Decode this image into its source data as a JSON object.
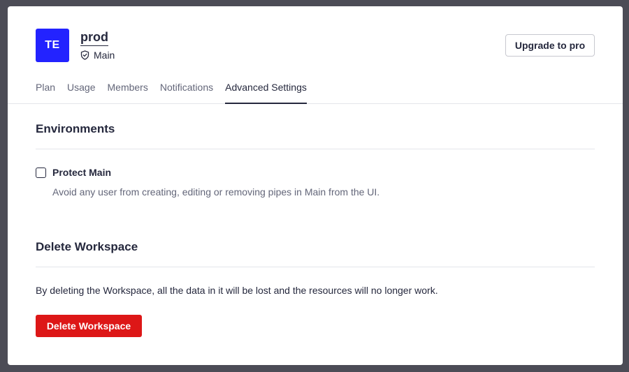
{
  "workspace": {
    "avatar_initials": "TE",
    "name": "prod",
    "environment_label": "Main",
    "environment_icon": "shield-icon",
    "avatar_color": "#2323ff"
  },
  "header": {
    "upgrade_label": "Upgrade to pro"
  },
  "tabs": [
    {
      "label": "Plan",
      "active": false
    },
    {
      "label": "Usage",
      "active": false
    },
    {
      "label": "Members",
      "active": false
    },
    {
      "label": "Notifications",
      "active": false
    },
    {
      "label": "Advanced Settings",
      "active": true
    }
  ],
  "environments": {
    "title": "Environments",
    "protect_main": {
      "label": "Protect Main",
      "checked": false,
      "description": "Avoid any user from creating, editing or removing pipes in Main from the UI."
    }
  },
  "delete_workspace": {
    "title": "Delete Workspace",
    "description": "By deleting the Workspace, all the data in it will be lost and the resources will no longer work.",
    "button_label": "Delete Workspace",
    "button_color": "#dd1717"
  }
}
